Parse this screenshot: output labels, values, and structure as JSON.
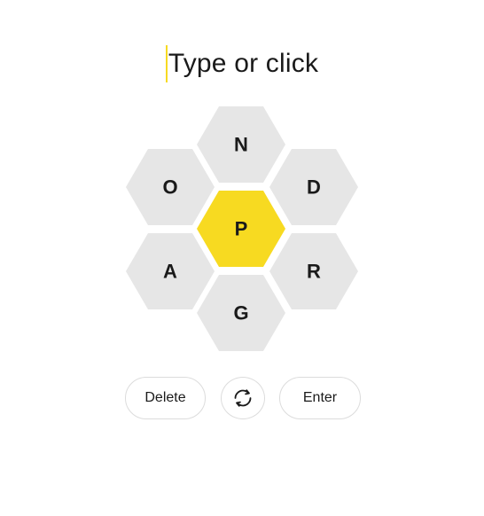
{
  "input": {
    "placeholder": "Type or click"
  },
  "hive": {
    "center_letter": "P",
    "outer_letters": {
      "top": "N",
      "upper_left": "O",
      "upper_right": "D",
      "lower_left": "A",
      "lower_right": "R",
      "bottom": "G"
    }
  },
  "controls": {
    "delete_label": "Delete",
    "shuffle_icon": "shuffle-icon",
    "enter_label": "Enter"
  },
  "colors": {
    "center_cell": "#f7da21",
    "outer_cell": "#e6e6e6",
    "caret": "#f7da21",
    "text": "#1a1a1a"
  }
}
